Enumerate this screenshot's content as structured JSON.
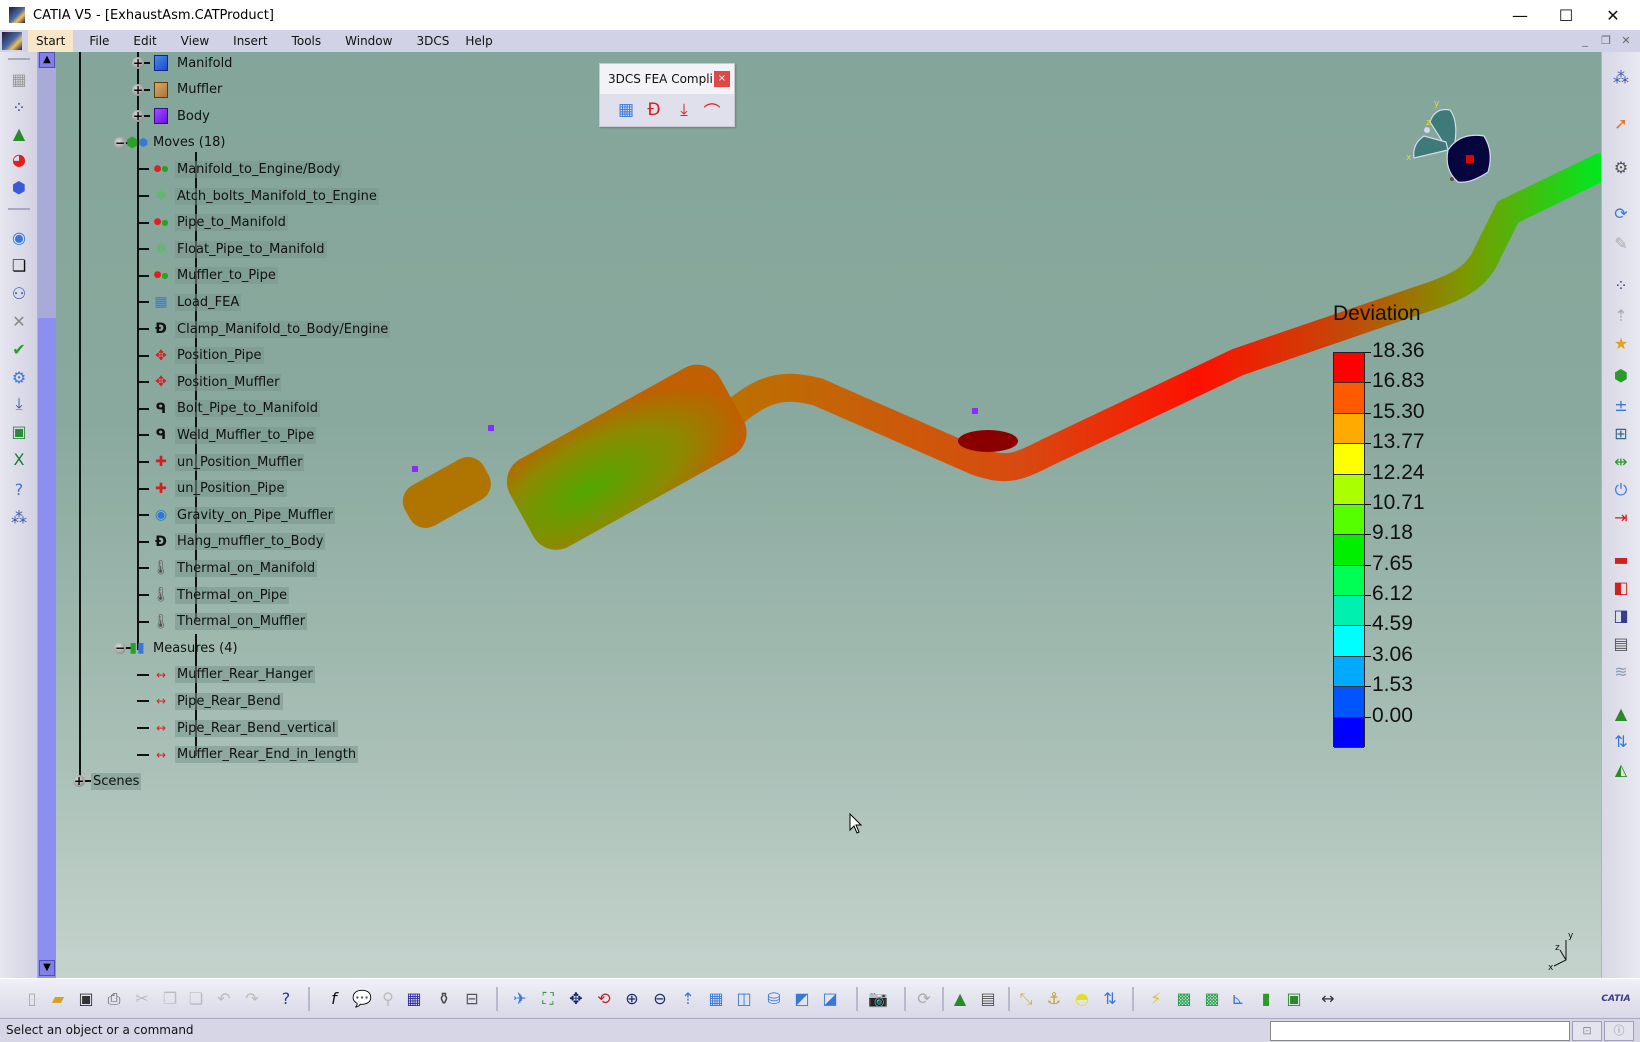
{
  "window": {
    "title": "CATIA V5 - [ExhaustAsm.CATProduct]",
    "minimize": "—",
    "maximize": "☐",
    "close": "✕"
  },
  "menu": {
    "items": [
      {
        "label": "Start",
        "active": true
      },
      {
        "label": "File"
      },
      {
        "label": "Edit"
      },
      {
        "label": "View"
      },
      {
        "label": "Insert"
      },
      {
        "label": "Tools"
      },
      {
        "label": "Window"
      },
      {
        "label": "3DCS"
      },
      {
        "label": "Help"
      }
    ],
    "doc_minimize": "_",
    "doc_restore": "❐",
    "doc_close": "✕"
  },
  "tree": {
    "parts": [
      {
        "label": "Manifold",
        "icon": "part-blue-cube-icon"
      },
      {
        "label": "Muffler",
        "icon": "part-tan-cube-icon"
      },
      {
        "label": "Body",
        "icon": "part-purple-cube-icon"
      }
    ],
    "moves_label": "Moves (18)",
    "moves": [
      {
        "label": "Manifold_to_Engine/Body",
        "icon": "point-move-icon"
      },
      {
        "label": "Atch_bolts_Manifold_to_Engine",
        "icon": "float-move-icon"
      },
      {
        "label": "Pipe_to_Manifold",
        "icon": "point-move-icon"
      },
      {
        "label": "Float_Pipe_to_Manifold",
        "icon": "float-move-icon"
      },
      {
        "label": "Muffler_to_Pipe",
        "icon": "point-move-icon"
      },
      {
        "label": "Load_FEA",
        "icon": "load-fea-icon"
      },
      {
        "label": "Clamp_Manifold_to_Body/Engine",
        "icon": "clamp-icon"
      },
      {
        "label": "Position_Pipe",
        "icon": "position-icon"
      },
      {
        "label": "Position_Muffler",
        "icon": "position-icon"
      },
      {
        "label": "Bolt_Pipe_to_Manifold",
        "icon": "bolt-icon"
      },
      {
        "label": "Weld_Muffler_to_Pipe",
        "icon": "weld-icon"
      },
      {
        "label": "un_Position_Muffler",
        "icon": "unposition-icon"
      },
      {
        "label": "un_Position_Pipe",
        "icon": "unposition-icon"
      },
      {
        "label": "Gravity_on_Pipe_Muffler",
        "icon": "gravity-icon"
      },
      {
        "label": "Hang_muffler_to_Body",
        "icon": "clamp-icon"
      },
      {
        "label": "Thermal_on_Manifold",
        "icon": "thermal-icon"
      },
      {
        "label": "Thermal_on_Pipe",
        "icon": "thermal-icon"
      },
      {
        "label": "Thermal_on_Muffler",
        "icon": "thermal-icon"
      }
    ],
    "measures_label": "Measures (4)",
    "measures": [
      {
        "label": "Muffler_Rear_Hanger"
      },
      {
        "label": "Pipe_Rear_Bend"
      },
      {
        "label": "Pipe_Rear_Bend_vertical"
      },
      {
        "label": "Muffler_Rear_End_in_length"
      }
    ],
    "scenes_label": "Scenes"
  },
  "fea_toolbar": {
    "title": "3DCS FEA Compli...",
    "close": "×",
    "icons": [
      "mesh-add-icon",
      "clamp-red-icon",
      "load-down-icon",
      "deformed-shape-icon"
    ]
  },
  "legend": {
    "title": "Deviation",
    "labels": [
      "18.36",
      "16.83",
      "15.30",
      "13.77",
      "12.24",
      "10.71",
      "9.18",
      "7.65",
      "6.12",
      "4.59",
      "3.06",
      "1.53",
      "0.00"
    ],
    "colors": [
      "#ff0000",
      "#ff5a00",
      "#ffaa00",
      "#ffff00",
      "#aaff00",
      "#55ff00",
      "#00ee00",
      "#00ff55",
      "#00f0b0",
      "#00ffff",
      "#00aaff",
      "#0055ff",
      "#0000ff"
    ]
  },
  "compass": {
    "x_label": "x",
    "y_label": "y",
    "z_label": "z"
  },
  "axis_triad": {
    "x_label": "x",
    "y_label": "y",
    "z_label": "z"
  },
  "status": {
    "message": "Select an object or a command",
    "command_input": ""
  },
  "brand": {
    "logo_text": "CATIA"
  }
}
